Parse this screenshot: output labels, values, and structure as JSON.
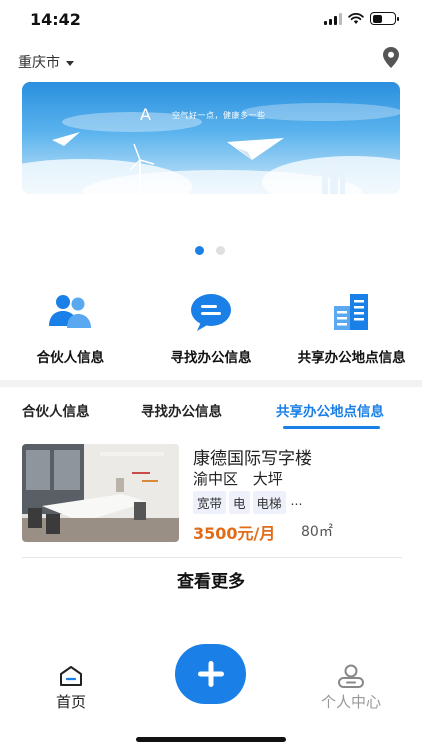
{
  "status_bar": {
    "time": "14:42"
  },
  "header": {
    "city": "重庆市"
  },
  "banner": {
    "slogan": "空气好一点，健康多一些"
  },
  "carousel": {
    "count": 2,
    "active_index": 0
  },
  "categories": [
    {
      "label": "合伙人信息",
      "icon": "partners-icon"
    },
    {
      "label": "寻找办公信息",
      "icon": "chat-bubble-icon"
    },
    {
      "label": "共享办公地点信息",
      "icon": "buildings-icon"
    }
  ],
  "tabs": [
    {
      "label": "合伙人信息",
      "active": false
    },
    {
      "label": "寻找办公信息",
      "active": false
    },
    {
      "label": "共享办公地点信息",
      "active": true
    }
  ],
  "listing": {
    "title": "康德国际写字楼",
    "location": "渝中区 大坪",
    "tags": [
      "宽带",
      "电",
      "电梯"
    ],
    "tags_more": "...",
    "price": "3500元/月",
    "area": "80㎡"
  },
  "view_more": "查看更多",
  "bottom_nav": {
    "home_label": "首页",
    "profile_label": "个人中心",
    "fab_icon": "plus-icon"
  },
  "colors": {
    "accent": "#1a7fe6",
    "price": "#e06c1a"
  }
}
